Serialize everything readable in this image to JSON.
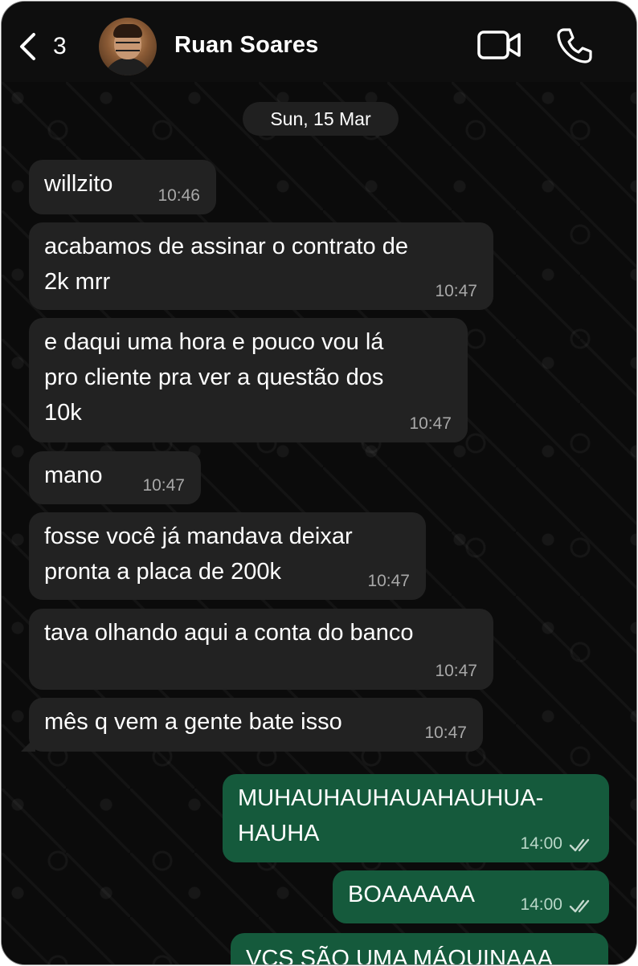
{
  "header": {
    "back_count": "3",
    "contact_name": "Ruan Soares",
    "avatar_label": "Ruan Soares avatar",
    "video_call_label": "Video call",
    "voice_call_label": "Voice call"
  },
  "chat": {
    "date": "Sun, 15 Mar",
    "messages": [
      {
        "direction": "in",
        "text": "willzito",
        "time": "10:46"
      },
      {
        "direction": "in",
        "text": "acabamos de assinar o contrato de\n2k mrr",
        "time": "10:47"
      },
      {
        "direction": "in",
        "text": "e daqui uma hora e pouco vou lá\npro cliente pra ver a questão dos\n10k",
        "time": "10:47"
      },
      {
        "direction": "in",
        "text": "mano",
        "time": "10:47"
      },
      {
        "direction": "in",
        "text": "fosse você já mandava deixar\npronta a placa de 200k",
        "time": "10:47"
      },
      {
        "direction": "in",
        "text": "tava olhando aqui a conta do banco",
        "time": "10:47"
      },
      {
        "direction": "in",
        "text": "mês q vem a gente bate isso",
        "time": "10:47"
      },
      {
        "direction": "out",
        "text": "MUHAUHAUHAUAHAUHUA-\nHAUHA",
        "time": "14:00",
        "status": "read"
      },
      {
        "direction": "out",
        "text": "BOAAAAAA",
        "time": "14:00",
        "status": "read"
      },
      {
        "direction": "out",
        "text": "VCS SÃO UMA MÁQUINAAA",
        "time": "",
        "status": ""
      }
    ]
  },
  "colors": {
    "incoming_bubble": "#222222",
    "outgoing_bubble": "#155a3c",
    "background": "#0b0b0b",
    "text": "#ffffff"
  }
}
